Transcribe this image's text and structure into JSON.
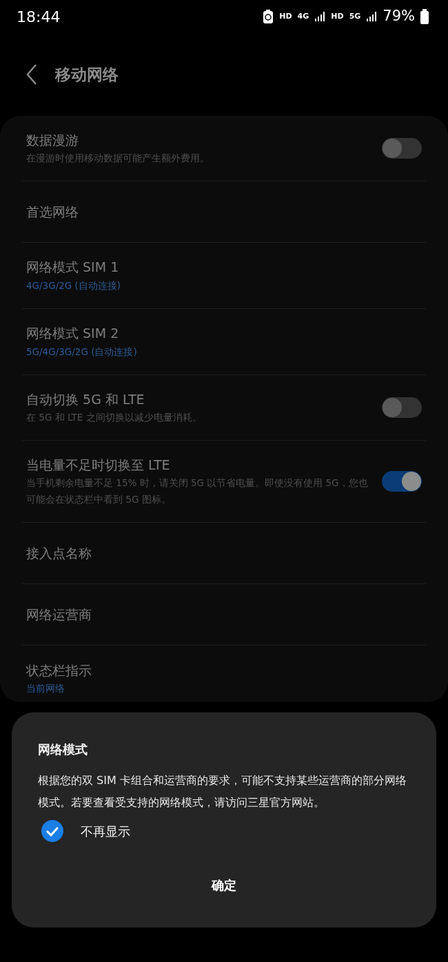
{
  "status_bar": {
    "time": "18:44",
    "indicators": [
      "HD",
      "4G",
      "HD",
      "5G"
    ],
    "battery": "79%"
  },
  "header": {
    "title": "移动网络"
  },
  "settings": [
    {
      "kind": "switch",
      "title": "数据漫游",
      "subtitle": "在漫游时使用移动数据可能产生额外费用。",
      "on": false
    },
    {
      "kind": "plain",
      "title": "首选网络"
    },
    {
      "kind": "value",
      "title": "网络模式 SIM 1",
      "subtitle": "4G/3G/2G (自动连接)"
    },
    {
      "kind": "value",
      "title": "网络模式 SIM 2",
      "subtitle": "5G/4G/3G/2G (自动连接)"
    },
    {
      "kind": "switch",
      "title": "自动切换 5G 和 LTE",
      "subtitle": "在 5G 和 LTE 之间切换以减少电量消耗。",
      "on": false
    },
    {
      "kind": "switch",
      "title": "当电量不足时切换至 LTE",
      "subtitle": "当手机剩余电量不足 15% 时，请关闭 5G 以节省电量。即使没有使用 5G，您也可能会在状态栏中看到 5G 图标。",
      "on": true
    },
    {
      "kind": "plain",
      "title": "接入点名称"
    },
    {
      "kind": "plain",
      "title": "网络运营商"
    },
    {
      "kind": "value",
      "title": "状态栏指示",
      "subtitle": "当前网络"
    }
  ],
  "dialog": {
    "title": "网络模式",
    "message": "根据您的双 SIM 卡组合和运营商的要求，可能不支持某些运营商的部分网络模式。若要查看受支持的网络模式，请访问三星官方网站。",
    "checkbox": {
      "label": "不再显示",
      "checked": true
    },
    "button": "确定"
  }
}
